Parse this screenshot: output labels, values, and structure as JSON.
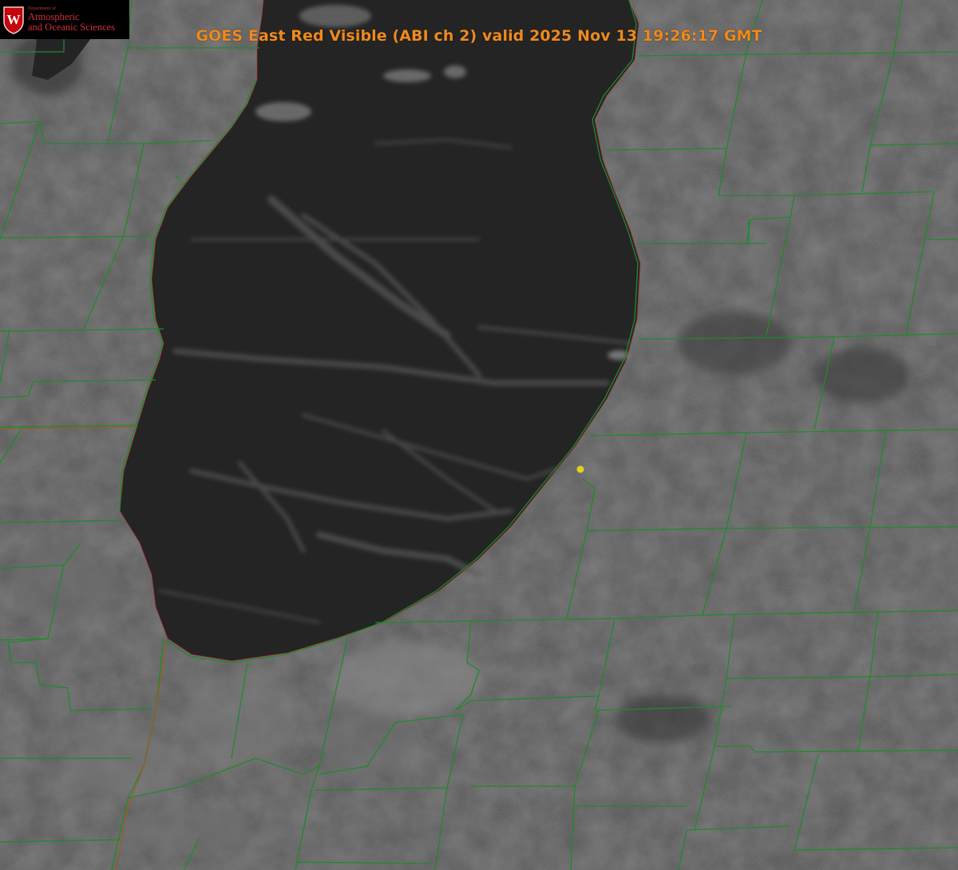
{
  "header": {
    "title": "GOES East Red Visible (ABI ch 2) valid 2025 Nov 13 19:26:17 GMT"
  },
  "logo": {
    "department": "Department of",
    "line1": "Atmospheric",
    "line2": "and Oceanic Sciences",
    "crest_letter": "W"
  },
  "colors": {
    "title": "#f08a1e",
    "county_lines": "#1f8a2a",
    "coastline": "#d42020",
    "state_line": "#9a5a28",
    "marker": "#e0d020",
    "land": "#4a4a4a",
    "lake": "#242424"
  },
  "map": {
    "product": "GOES East Red Visible",
    "channel": "ABI ch 2",
    "layers": [
      "satellite-imagery",
      "county-boundaries",
      "lake-shoreline",
      "state-boundary",
      "site-marker"
    ]
  }
}
